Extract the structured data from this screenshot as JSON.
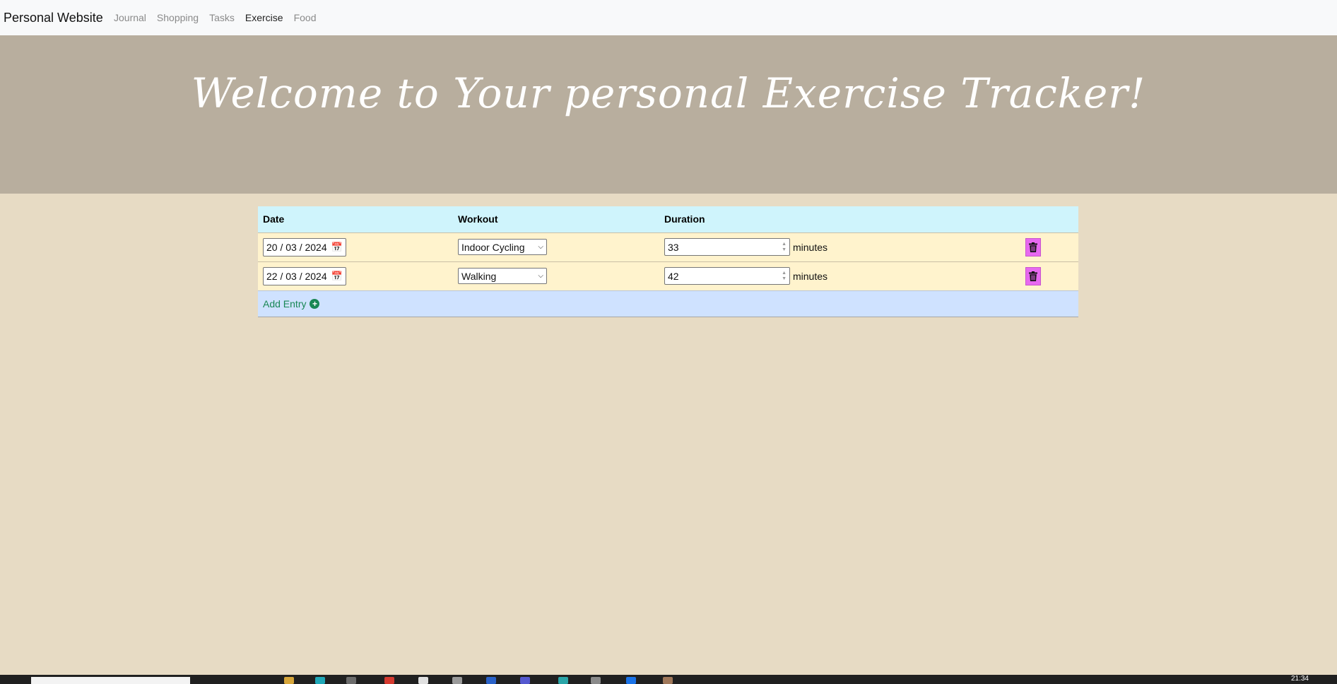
{
  "navbar": {
    "brand": "Personal Website",
    "links": [
      "Journal",
      "Shopping",
      "Tasks",
      "Exercise",
      "Food"
    ],
    "active": "Exercise"
  },
  "hero": {
    "title": "Welcome to Your personal Exercise Tracker!"
  },
  "table": {
    "headers": {
      "date": "Date",
      "workout": "Workout",
      "duration": "Duration"
    },
    "rows": [
      {
        "date": "20 / 03 / 2024",
        "workout": "Indoor Cycling",
        "duration": "33",
        "unit": "minutes"
      },
      {
        "date": "22 / 03 / 2024",
        "workout": "Walking",
        "duration": "42",
        "unit": "minutes"
      }
    ],
    "add_entry": "Add Entry"
  },
  "icons": {
    "calendar": "calendar-icon",
    "trash": "trash-icon",
    "plus": "plus-circle-icon",
    "chevron": "chevron-down-icon"
  },
  "colors": {
    "background": "#e7dbc4",
    "hero": "#b8ae9e",
    "header_row": "#cff4fc",
    "entry_row": "#fff3cd",
    "add_row": "#cfe2ff",
    "delete_button": "#e769f0",
    "add_text": "#198754"
  },
  "taskbar": {
    "clock": "21:34"
  }
}
